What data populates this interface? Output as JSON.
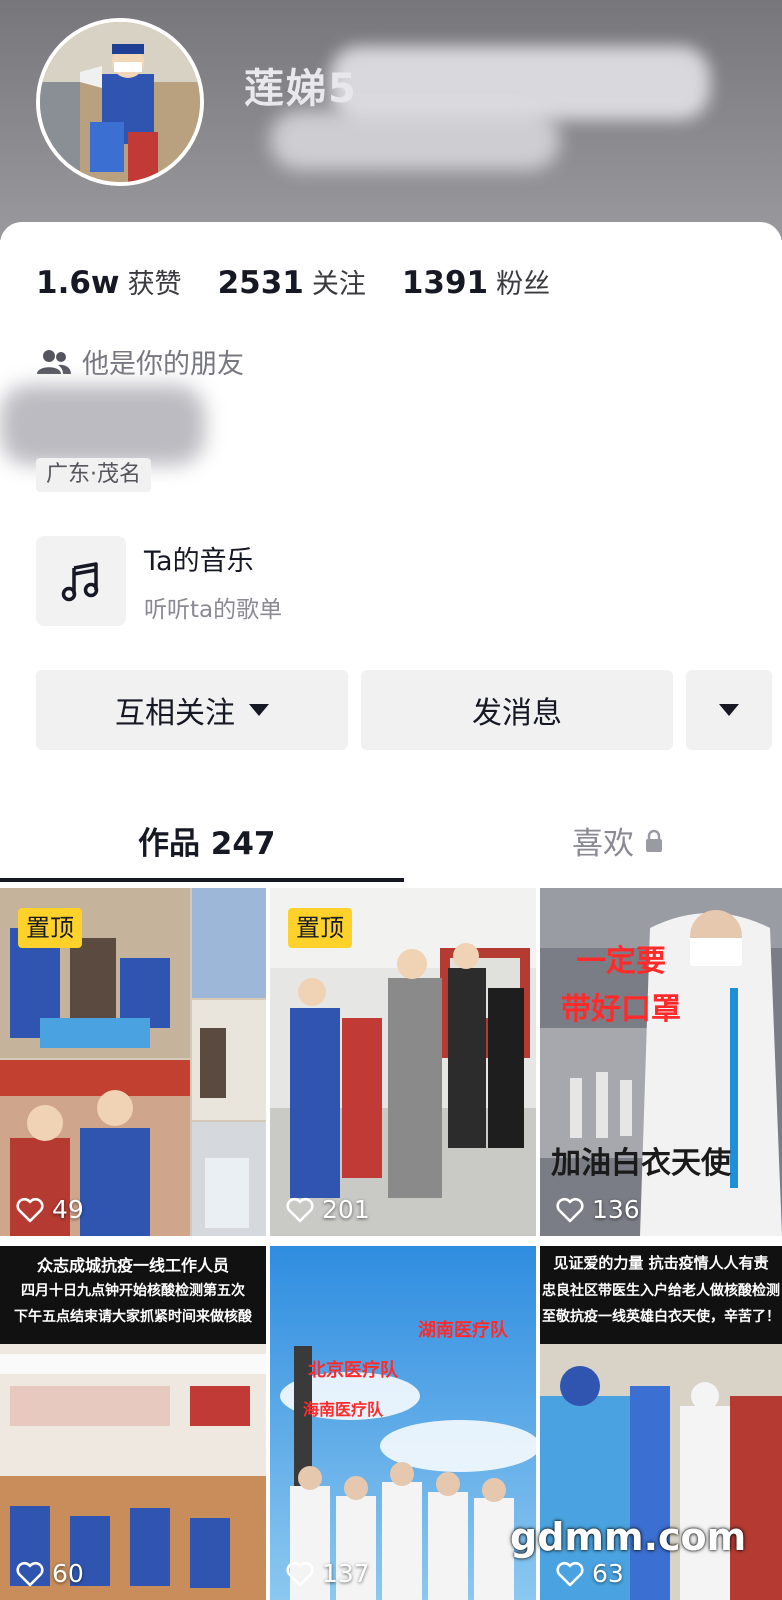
{
  "profile": {
    "username": "莲娣5"
  },
  "stats": [
    {
      "num": "1.6w",
      "label": "获赞"
    },
    {
      "num": "2531",
      "label": "关注"
    },
    {
      "num": "1391",
      "label": "粉丝"
    }
  ],
  "friend_text": "他是你的朋友",
  "location": "广东·茂名",
  "music": {
    "title": "Ta的音乐",
    "subtitle": "听听ta的歌单",
    "icon": "music-note-icon"
  },
  "buttons": {
    "follow": "互相关注",
    "message": "发消息"
  },
  "tabs": {
    "works": "作品 247",
    "likes": "喜欢"
  },
  "pin_label": "置顶",
  "videos": [
    {
      "likes": "49",
      "pinned": true
    },
    {
      "likes": "201",
      "pinned": true
    },
    {
      "likes": "136",
      "pinned": false,
      "caption_top": "一定要",
      "caption_mid": "带好口罩",
      "caption_bottom": "加油白衣天使"
    },
    {
      "likes": "60",
      "pinned": false,
      "caption_lines": [
        "众志成城抗疫一线工作人员",
        "四月十日九点钟开始核酸检测第五次",
        "下午五点结束请大家抓紧时间来做核酸"
      ]
    },
    {
      "likes": "137",
      "pinned": false,
      "caption_lines": [
        "北京医疗队",
        "湖南医疗队",
        "海南医疗队"
      ]
    },
    {
      "likes": "63",
      "pinned": false,
      "caption_lines": [
        "见证爱的力量 抗击疫情人人有责",
        "忠良社区带医生入户给老人做核酸检测",
        "至敬抗疫一线英雄白衣天使，辛苦了！"
      ]
    }
  ],
  "watermark": "gdmm.com"
}
